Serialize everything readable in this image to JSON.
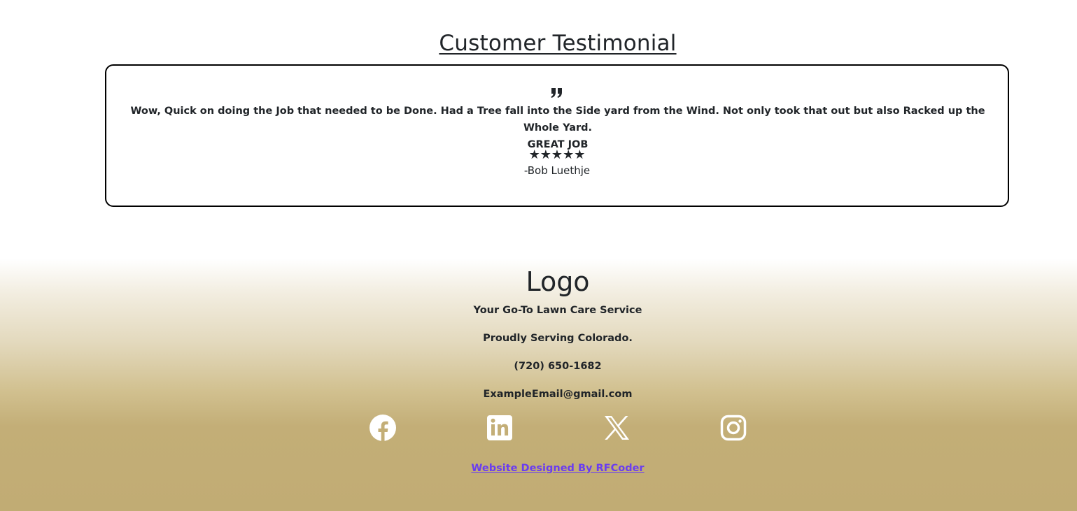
{
  "testimonial": {
    "title": "Customer Testimonial",
    "quote_icon": "quote-icon",
    "review_line1": "Wow, Quick on doing the Job that needed to be Done. Had a Tree fall into the Side yard from the Wind. Not only took that out but also Racked up the Whole Yard.",
    "review_line2": "GREAT JOB",
    "stars": "★★★★★",
    "rating": 5,
    "reviewer": "-Bob Luethje"
  },
  "footer": {
    "logo": "Logo",
    "tagline": "Your Go-To Lawn Care Service",
    "service_area": "Proudly Serving Colorado.",
    "phone": "(720) 650-1682",
    "email": "ExampleEmail@gmail.com",
    "social_icons": [
      "facebook-icon",
      "linkedin-icon",
      "x-icon",
      "instagram-icon"
    ],
    "designer_link": "Website Designed By RFCoder"
  },
  "colors": {
    "text": "#212529",
    "card_border": "#000000",
    "footer_gold": "#c1ac74",
    "link": "#6a3df0",
    "icon": "#ffffff"
  }
}
